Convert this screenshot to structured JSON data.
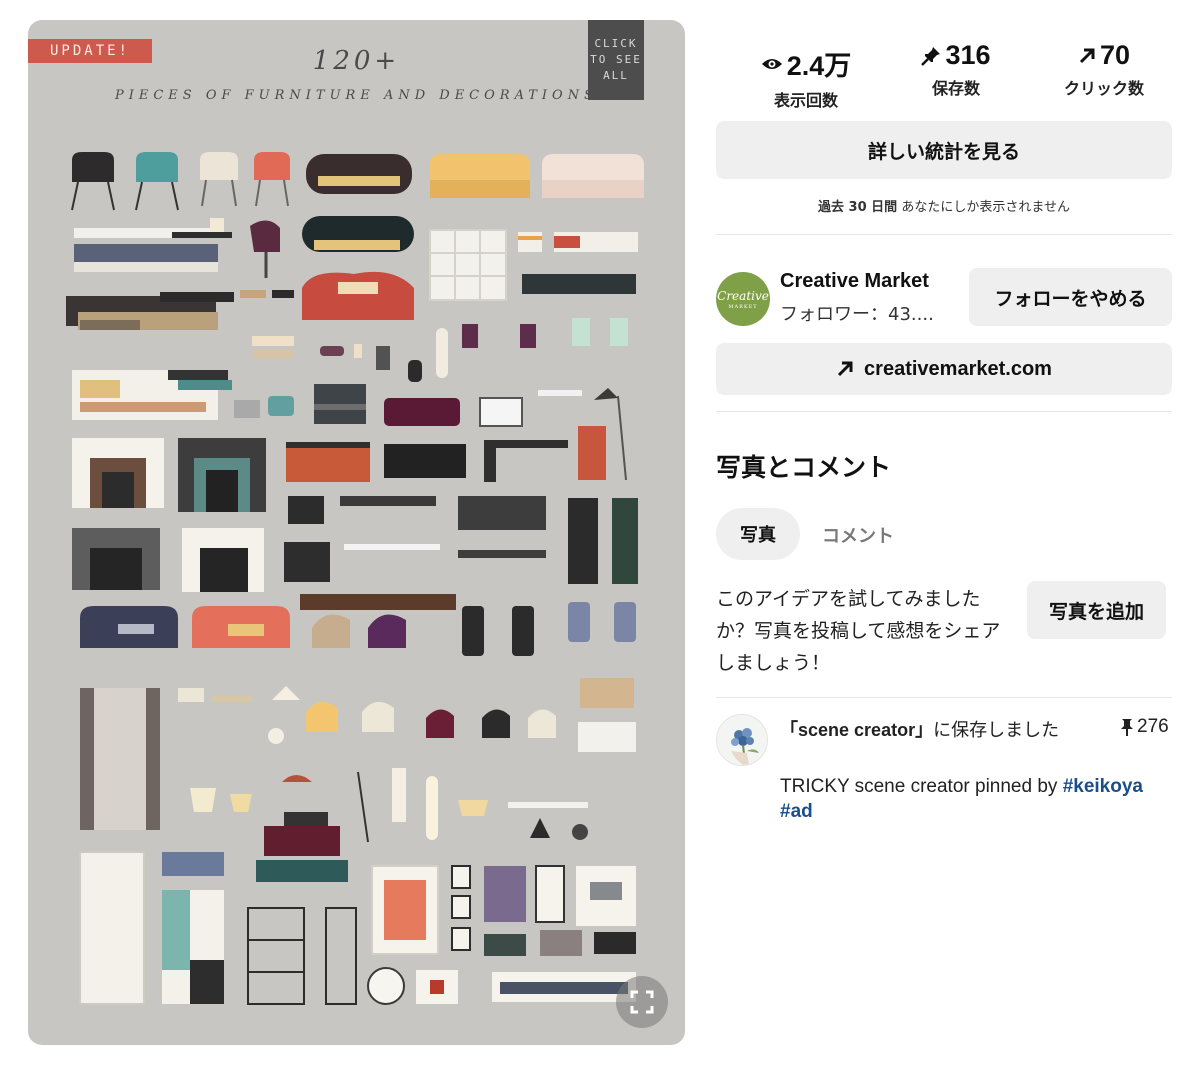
{
  "pin_image": {
    "badge": "UPDATE!",
    "count_title": "120+",
    "subtitle": "PIECES OF FURNITURE AND DECORATIONS",
    "click_box": [
      "CLICK",
      "TO SEE",
      "ALL"
    ],
    "expand_icon": "expand-icon"
  },
  "stats": {
    "views": {
      "value": "2.4万",
      "label": "表示回数",
      "icon": "eye-icon"
    },
    "saves": {
      "value": "316",
      "label": "保存数",
      "icon": "pin-icon"
    },
    "clicks": {
      "value": "70",
      "label": "クリック数",
      "icon": "arrow-up-right-icon"
    }
  },
  "stats_button": "詳しい統計を見る",
  "privacy": {
    "period": "過去 30 日間",
    "note": "あなたにしか表示されません"
  },
  "profile": {
    "avatar_text": "Creative",
    "avatar_sub": "MARKET",
    "name": "Creative Market",
    "followers": "フォロワー：43....",
    "follow_button": "フォローをやめる",
    "brand_color": "#7fa047"
  },
  "website_button": "creativemarket.com",
  "photos_section": {
    "title": "写真とコメント",
    "tabs": {
      "photo": "写真",
      "comment": "コメント"
    },
    "prompt": "このアイデアを試してみましたか？写真を投稿して感想をシェアしましょう！",
    "add_button": "写真を追加"
  },
  "activity": {
    "board": "「scene creator」",
    "saved_text": "に保存しました",
    "pin_count": "276",
    "desc_text": "TRICKY scene creator pinned by ",
    "hashtag1": "#keikoya",
    "hashtag2": "#ad",
    "hashtag_color": "#1a4f8b"
  }
}
